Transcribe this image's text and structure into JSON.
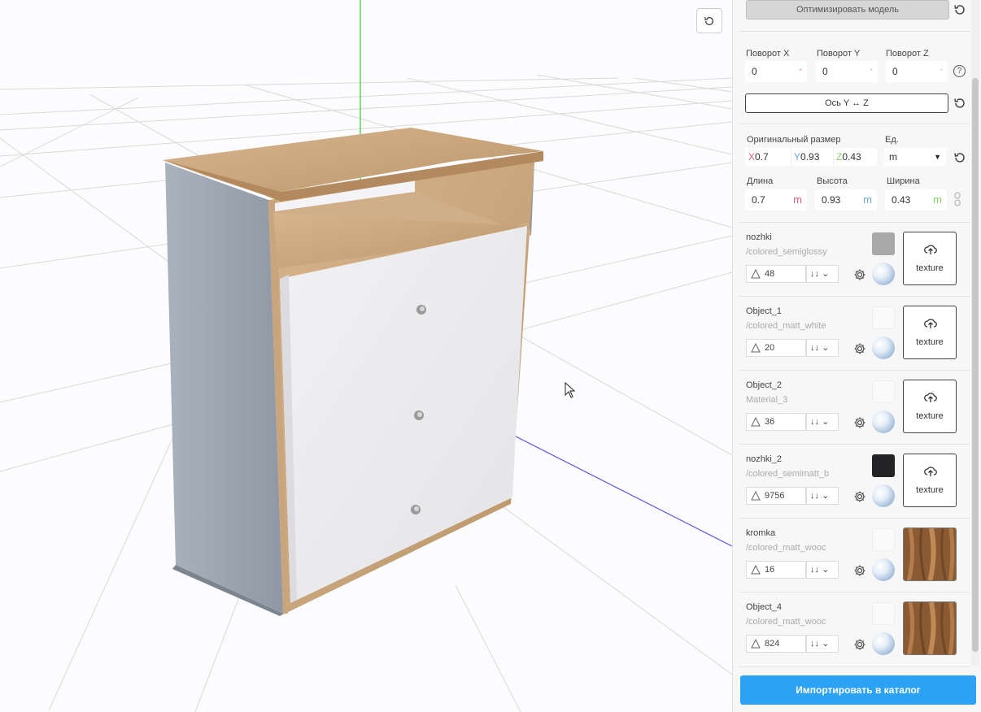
{
  "toolbar": {
    "optimize_label": "Оптимизировать модель"
  },
  "rotation": {
    "x_label": "Поворот X",
    "y_label": "Поворот Y",
    "z_label": "Поворот Z",
    "x_value": "0",
    "y_value": "0",
    "z_value": "0",
    "unit": "°",
    "help": "?",
    "axis_swap_label": "Ось Y ↔ Z"
  },
  "size": {
    "original_label": "Оригинальный размер",
    "units_label": "Ед.",
    "x_axis": "X",
    "x_value": "0.7",
    "y_axis": "Y",
    "y_value": "0.93",
    "z_axis": "Z",
    "z_value": "0.43",
    "unit_selected": "m",
    "length_label": "Длина",
    "height_label": "Высота",
    "width_label": "Ширина",
    "length_value": "0.7",
    "height_value": "0.93",
    "width_value": "0.43",
    "length_unit": "m",
    "height_unit": "m",
    "width_unit": "m"
  },
  "materials": [
    {
      "name": "nozhki",
      "material": "/colored_semiglossy",
      "triangles": "48",
      "sort": "↓↓",
      "swatch_color": "#a8a8a8",
      "texture_label": "texture",
      "has_texture_image": false
    },
    {
      "name": "Object_1",
      "material": "/colored_matt_white",
      "triangles": "20",
      "sort": "↓↓",
      "swatch_color": "#fafafa",
      "texture_label": "texture",
      "has_texture_image": false
    },
    {
      "name": "Object_2",
      "material": "Material_3",
      "triangles": "36",
      "sort": "↓↓",
      "swatch_color": "#fafafa",
      "texture_label": "texture",
      "has_texture_image": false
    },
    {
      "name": "nozhki_2",
      "material": "/colored_semimatt_b",
      "triangles": "9756",
      "sort": "↓↓",
      "swatch_color": "#232325",
      "texture_label": "texture",
      "has_texture_image": false
    },
    {
      "name": "kromka",
      "material": "/colored_matt_wooc",
      "triangles": "16",
      "sort": "↓↓",
      "swatch_color": "#fafafa",
      "texture_label": "",
      "has_texture_image": true
    },
    {
      "name": "Object_4",
      "material": "/colored_matt_wooc",
      "triangles": "824",
      "sort": "↓↓",
      "swatch_color": "#fafafa",
      "texture_label": "",
      "has_texture_image": true
    }
  ],
  "footer": {
    "import_label": "Импортировать в каталог"
  },
  "colors": {
    "accent": "#2ca2f5",
    "axis_x": "#e0607a",
    "axis_y": "#6aa8e0",
    "axis_z": "#8fcf6a",
    "y_axis_line": "#2fd32f",
    "z_axis_line": "#5a5ae6"
  }
}
